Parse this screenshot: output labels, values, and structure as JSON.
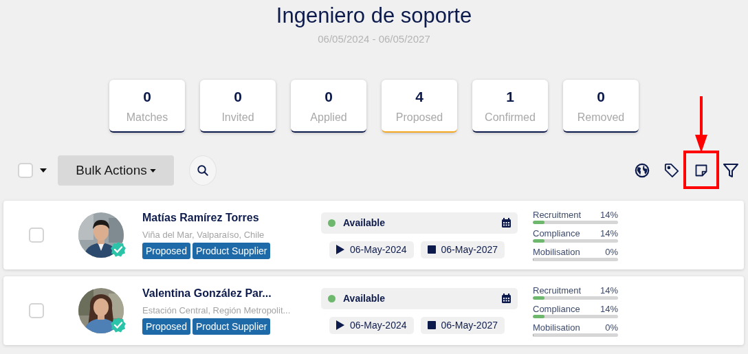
{
  "title": "Ingeniero de soporte",
  "date_range": "06/05/2024 - 06/05/2027",
  "stats": [
    {
      "count": "0",
      "label": "Matches",
      "selected": false
    },
    {
      "count": "0",
      "label": "Invited",
      "selected": false
    },
    {
      "count": "0",
      "label": "Applied",
      "selected": false
    },
    {
      "count": "4",
      "label": "Proposed",
      "selected": true
    },
    {
      "count": "1",
      "label": "Confirmed",
      "selected": false
    },
    {
      "count": "0",
      "label": "Removed",
      "selected": false
    }
  ],
  "toolbar": {
    "select_all_checked": false,
    "bulk_actions": "Bulk Actions",
    "tools": [
      {
        "kind": "globe",
        "highlighted": false
      },
      {
        "kind": "tag",
        "highlighted": false
      },
      {
        "kind": "note",
        "highlighted": true
      },
      {
        "kind": "filter",
        "highlighted": false
      }
    ]
  },
  "candidates": [
    {
      "checked": false,
      "name": "Matías Ramírez Torres",
      "location": "Viña del Mar, Valparaíso, Chile",
      "verified": true,
      "tags": [
        "Proposed",
        "Product Supplier"
      ],
      "status": {
        "label": "Available",
        "color": "#6db86d"
      },
      "start_date": "06-May-2024",
      "end_date": "06-May-2027",
      "progress": [
        {
          "label": "Recruitment",
          "reading": "14%",
          "level": 0.14
        },
        {
          "label": "Compliance",
          "reading": "14%",
          "level": 0.14
        },
        {
          "label": "Mobilisation",
          "reading": "0%",
          "level": 0
        }
      ]
    },
    {
      "checked": false,
      "name": "Valentina González Par...",
      "location": "Estación Central, Región Metropolit...",
      "verified": true,
      "tags": [
        "Proposed",
        "Product Supplier"
      ],
      "status": {
        "label": "Available",
        "color": "#6db86d"
      },
      "start_date": "06-May-2024",
      "end_date": "06-May-2027",
      "progress": [
        {
          "label": "Recruitment",
          "reading": "14%",
          "level": 0.14
        },
        {
          "label": "Compliance",
          "reading": "14%",
          "level": 0.14
        },
        {
          "label": "Mobilisation",
          "reading": "0%",
          "level": 0
        }
      ]
    }
  ]
}
